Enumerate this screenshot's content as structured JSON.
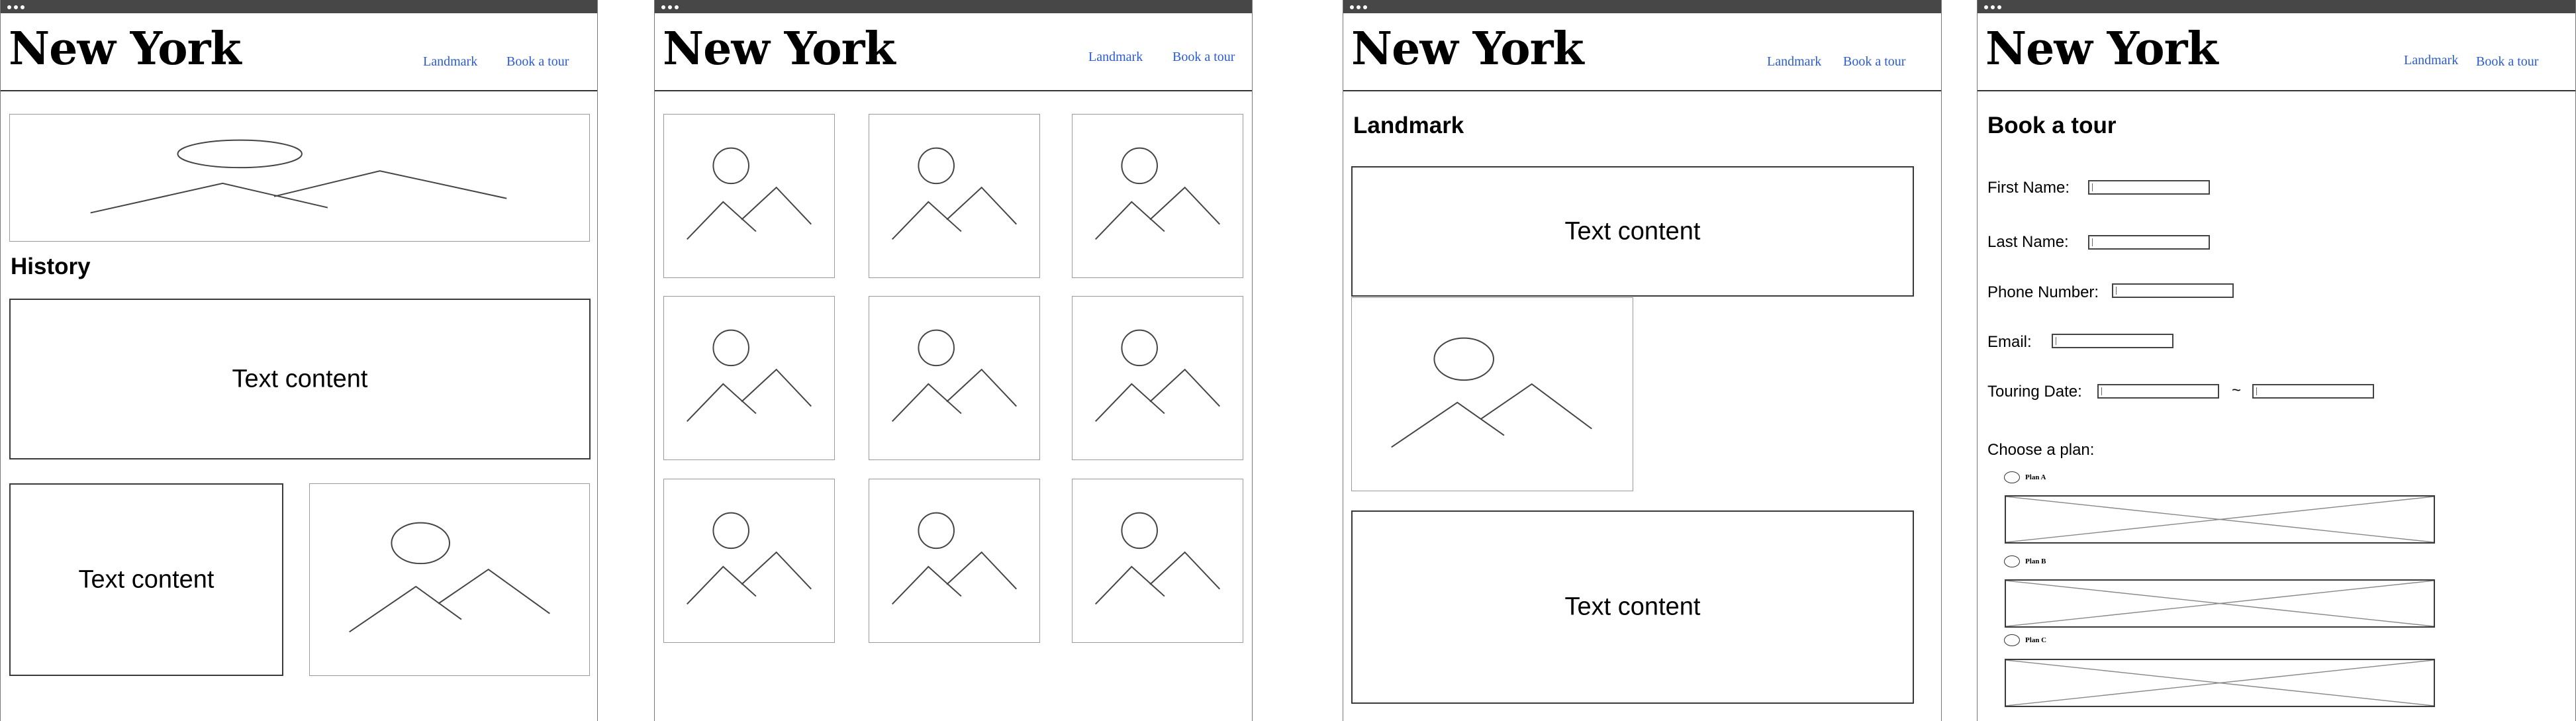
{
  "site": {
    "brand": "New York",
    "nav": {
      "landmark": "Landmark",
      "book_tour": "Book a tour"
    }
  },
  "home": {
    "history_heading": "History",
    "text_block_1": "Text content",
    "text_block_2": "Text content"
  },
  "landmark_page": {
    "heading": "Landmark",
    "text_block_1": "Text content",
    "text_block_2": "Text content"
  },
  "booking": {
    "heading": "Book a tour",
    "first_name_label": "First Name:",
    "last_name_label": "Last Name:",
    "phone_label": "Phone Number:",
    "email_label": "Email:",
    "date_label": "Touring Date:",
    "date_separator": "~",
    "choose_plan_label": "Choose a plan:",
    "plans": [
      {
        "label": "Plan A"
      },
      {
        "label": "Plan B"
      },
      {
        "label": "Plan C"
      }
    ]
  },
  "colors": {
    "window_bar": "#474747",
    "link": "#2a5bd7",
    "border_dark": "#3a3a3a",
    "border_light": "#9a9a9a"
  },
  "icons": {
    "image_placeholder": "mountain-sun-icon",
    "crossed_placeholder": "x-placeholder-icon"
  }
}
